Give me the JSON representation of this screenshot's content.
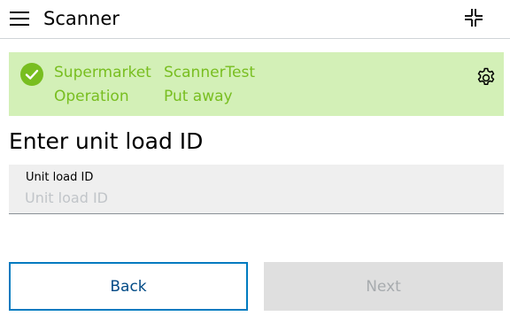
{
  "header": {
    "title": "Scanner",
    "menu_icon": "hamburger-menu-icon",
    "collapse_icon": "collapse-icon"
  },
  "banner": {
    "status_icon": "check-circle-icon",
    "label_1": "Supermarket",
    "value_1": "ScannerTest",
    "label_2": "Operation",
    "value_2": "Put away",
    "settings_icon": "gear-icon",
    "background_color": "#d3f0b7",
    "text_color": "#78be20"
  },
  "main": {
    "heading": "Enter unit load ID",
    "field": {
      "label": "Unit load ID",
      "placeholder": "Unit load ID",
      "value": ""
    }
  },
  "actions": {
    "back_label": "Back",
    "next_label": "Next",
    "back_border_color": "#007bc0"
  }
}
